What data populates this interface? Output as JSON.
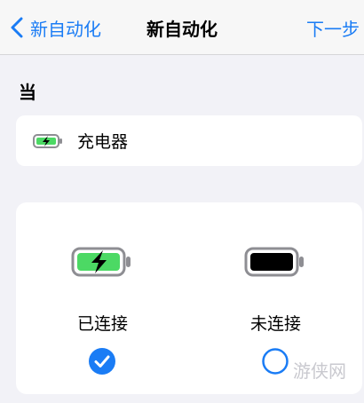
{
  "navbar": {
    "back_label": "新自动化",
    "title": "新自动化",
    "next_label": "下一步"
  },
  "section": {
    "header": "当"
  },
  "trigger": {
    "label": "充电器",
    "icon": "charging-battery-icon"
  },
  "options": [
    {
      "label": "已连接",
      "selected": true,
      "icon": "battery-charging-icon"
    },
    {
      "label": "未连接",
      "selected": false,
      "icon": "battery-full-icon"
    }
  ],
  "watermark": "游侠网",
  "colors": {
    "accent": "#1a7cf5",
    "battery_green": "#4cd964",
    "background": "#f2f2f7"
  }
}
